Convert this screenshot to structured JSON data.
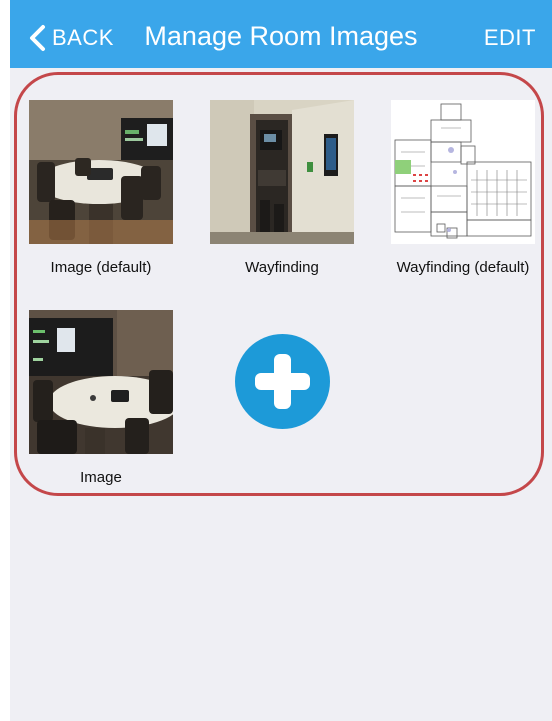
{
  "nav": {
    "back_label": "BACK",
    "title": "Manage Room Images",
    "edit_label": "EDIT",
    "bar_color": "#3aa6ea"
  },
  "images": [
    {
      "caption": "Image (default)",
      "kind": "conference-room-photo"
    },
    {
      "caption": "Wayfinding",
      "kind": "hallway-doorway-photo"
    },
    {
      "caption": "Wayfinding (default)",
      "kind": "floor-plan-map"
    },
    {
      "caption": "Image",
      "kind": "conference-room-photo"
    }
  ],
  "add_button": {
    "icon": "plus-icon",
    "color": "#1d9ad8"
  },
  "highlight_color": "#c4474a"
}
